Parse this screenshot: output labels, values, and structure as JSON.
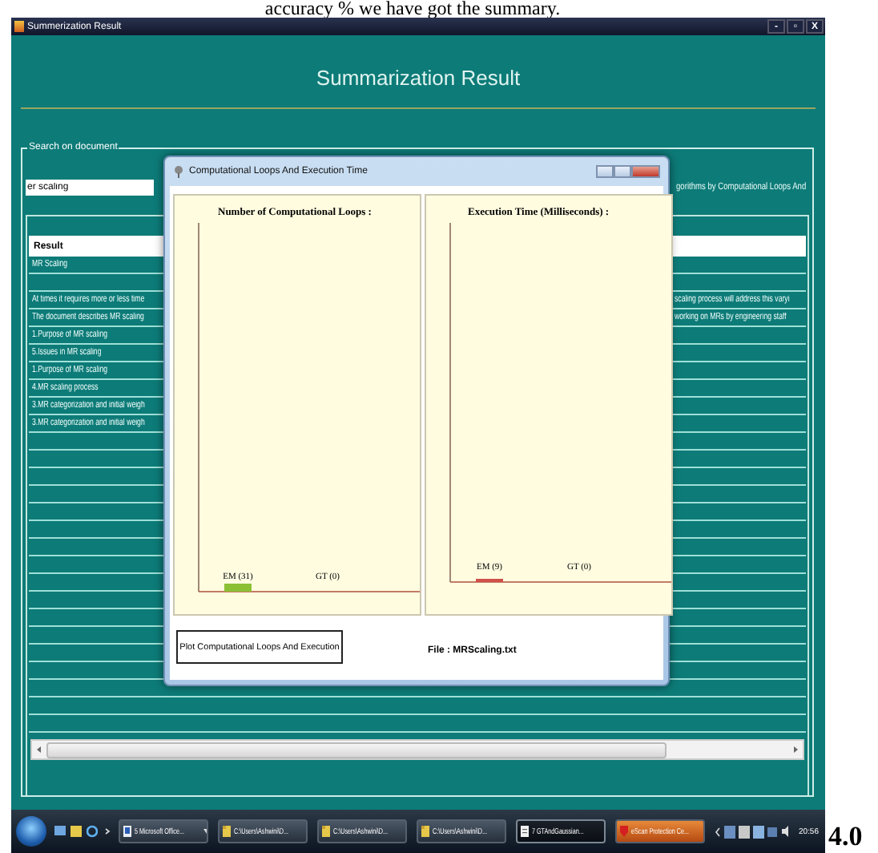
{
  "caption": "accuracy % we have got the summary.",
  "page_number": "4.0",
  "window": {
    "title": "Summerization Result",
    "controls": [
      "-",
      "▫",
      "X"
    ]
  },
  "heading": "Summarization Result",
  "search_group": {
    "legend": "Search on document",
    "field_value": "er scaling",
    "right_label": "gorithms by Computational Loops And"
  },
  "result": {
    "header": "Result",
    "title_row": "MR Scaling",
    "rows": [
      {
        "left": "At times it requires more or less time",
        "right": "scaling process will address this varyi"
      },
      {
        "left": "The document describes MR scaling",
        "right": "working on MRs by engineering staff"
      },
      {
        "left": "1.Purpose of MR scaling"
      },
      {
        "left": "5.Issues in MR scaling"
      },
      {
        "left": "1.Purpose of MR scaling"
      },
      {
        "left": "4.MR scaling process"
      },
      {
        "left": "3.MR categorization and initial weigh"
      },
      {
        "left": "3.MR categorization and initial weigh"
      }
    ]
  },
  "dialog": {
    "title": "Computational Loops And Execution Time",
    "charts": [
      {
        "title": "Number of Computational Loops :",
        "bars": [
          {
            "label": "EM (31)",
            "color": "#8cc034"
          },
          {
            "label": "GT (0)"
          }
        ]
      },
      {
        "title": "Execution Time (Milliseconds) :",
        "bars": [
          {
            "label": "EM (9)",
            "color": "#d0504a"
          },
          {
            "label": "GT (0)"
          }
        ]
      }
    ],
    "button": "Plot Computational Loops And Execution",
    "file_label": "File : MRScaling.txt"
  },
  "taskbar": {
    "items": [
      {
        "label": "5 Microsoft Office...",
        "kind": "office",
        "grouped": true,
        "selected": false
      },
      {
        "label": "C:\\Users\\Ashwini\\D...",
        "kind": "folder",
        "grouped": false,
        "selected": false
      },
      {
        "label": "C:\\Users\\Ashwini\\D...",
        "kind": "folder",
        "grouped": false,
        "selected": false
      },
      {
        "label": "C:\\Users\\Ashwini\\D...",
        "kind": "folder",
        "grouped": false,
        "selected": false
      },
      {
        "label": "7 GTAndGaussian...",
        "kind": "document",
        "grouped": true,
        "selected": true
      },
      {
        "label": "eScan Protection Ce...",
        "kind": "alert",
        "grouped": false,
        "selected": false
      }
    ],
    "clock": "20:56"
  }
}
